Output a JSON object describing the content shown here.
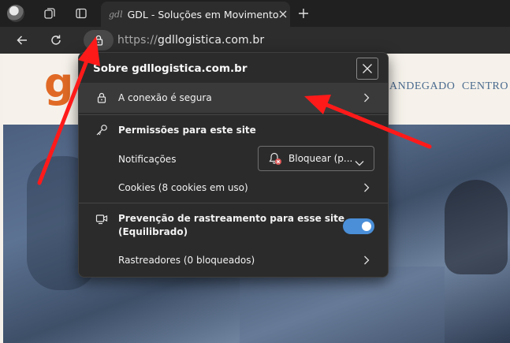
{
  "tab": {
    "favicon_text": "gdl",
    "title": "GDL - Soluções em Movimento"
  },
  "address_bar": {
    "scheme": "https://",
    "host": "gdllogistica.com.br"
  },
  "site": {
    "logo_text": "g",
    "nav_items": [
      "ANDEGADO",
      "CENTRO"
    ]
  },
  "popup": {
    "title": "Sobre gdllogistica.com.br",
    "connection_label": "A conexão é segura",
    "permissions_heading": "Permissões para este site",
    "notifications_label": "Notificações",
    "notifications_value": "Bloquear (p...",
    "cookies_label": "Cookies (8 cookies em uso)",
    "tracking_label_line1": "Prevenção de rastreamento para esse site",
    "tracking_label_line2": "(Equilibrado)",
    "tracking_enabled": true,
    "trackers_label": "Rastreadores (0 bloqueados)"
  },
  "colors": {
    "accent": "#4a8fd8",
    "annotation_arrow": "#ff1a1a",
    "brand_orange": "#e06a25"
  }
}
